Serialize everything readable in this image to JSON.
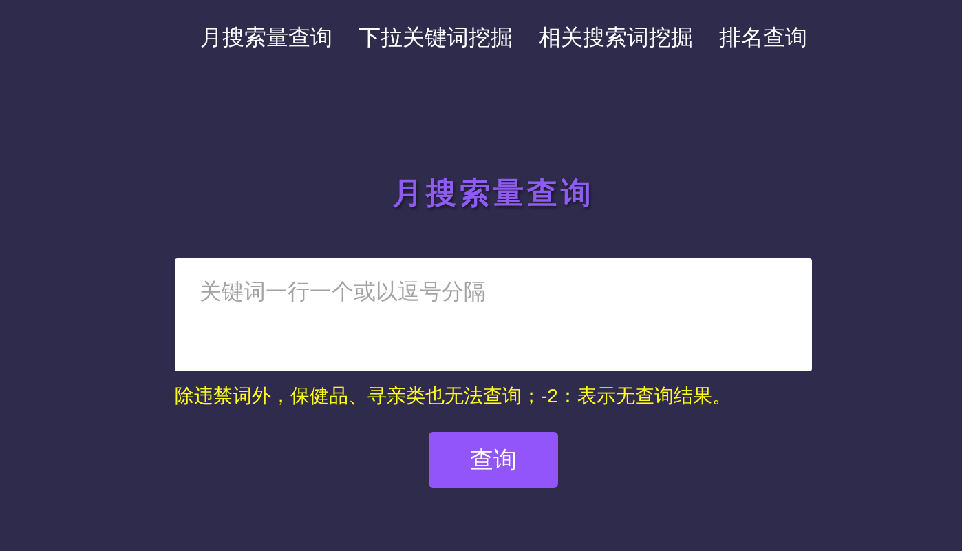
{
  "nav": {
    "items": [
      "月搜索量查询",
      "下拉关键词挖掘",
      "相关搜索词挖掘",
      "排名查询"
    ]
  },
  "heading": "月搜索量查询",
  "keyword_input": {
    "placeholder": "关键词一行一个或以逗号分隔"
  },
  "notice": "除违禁词外，保健品、寻亲类也无法查询；-2：表示无查询结果。",
  "query_button": {
    "label": "查询"
  }
}
